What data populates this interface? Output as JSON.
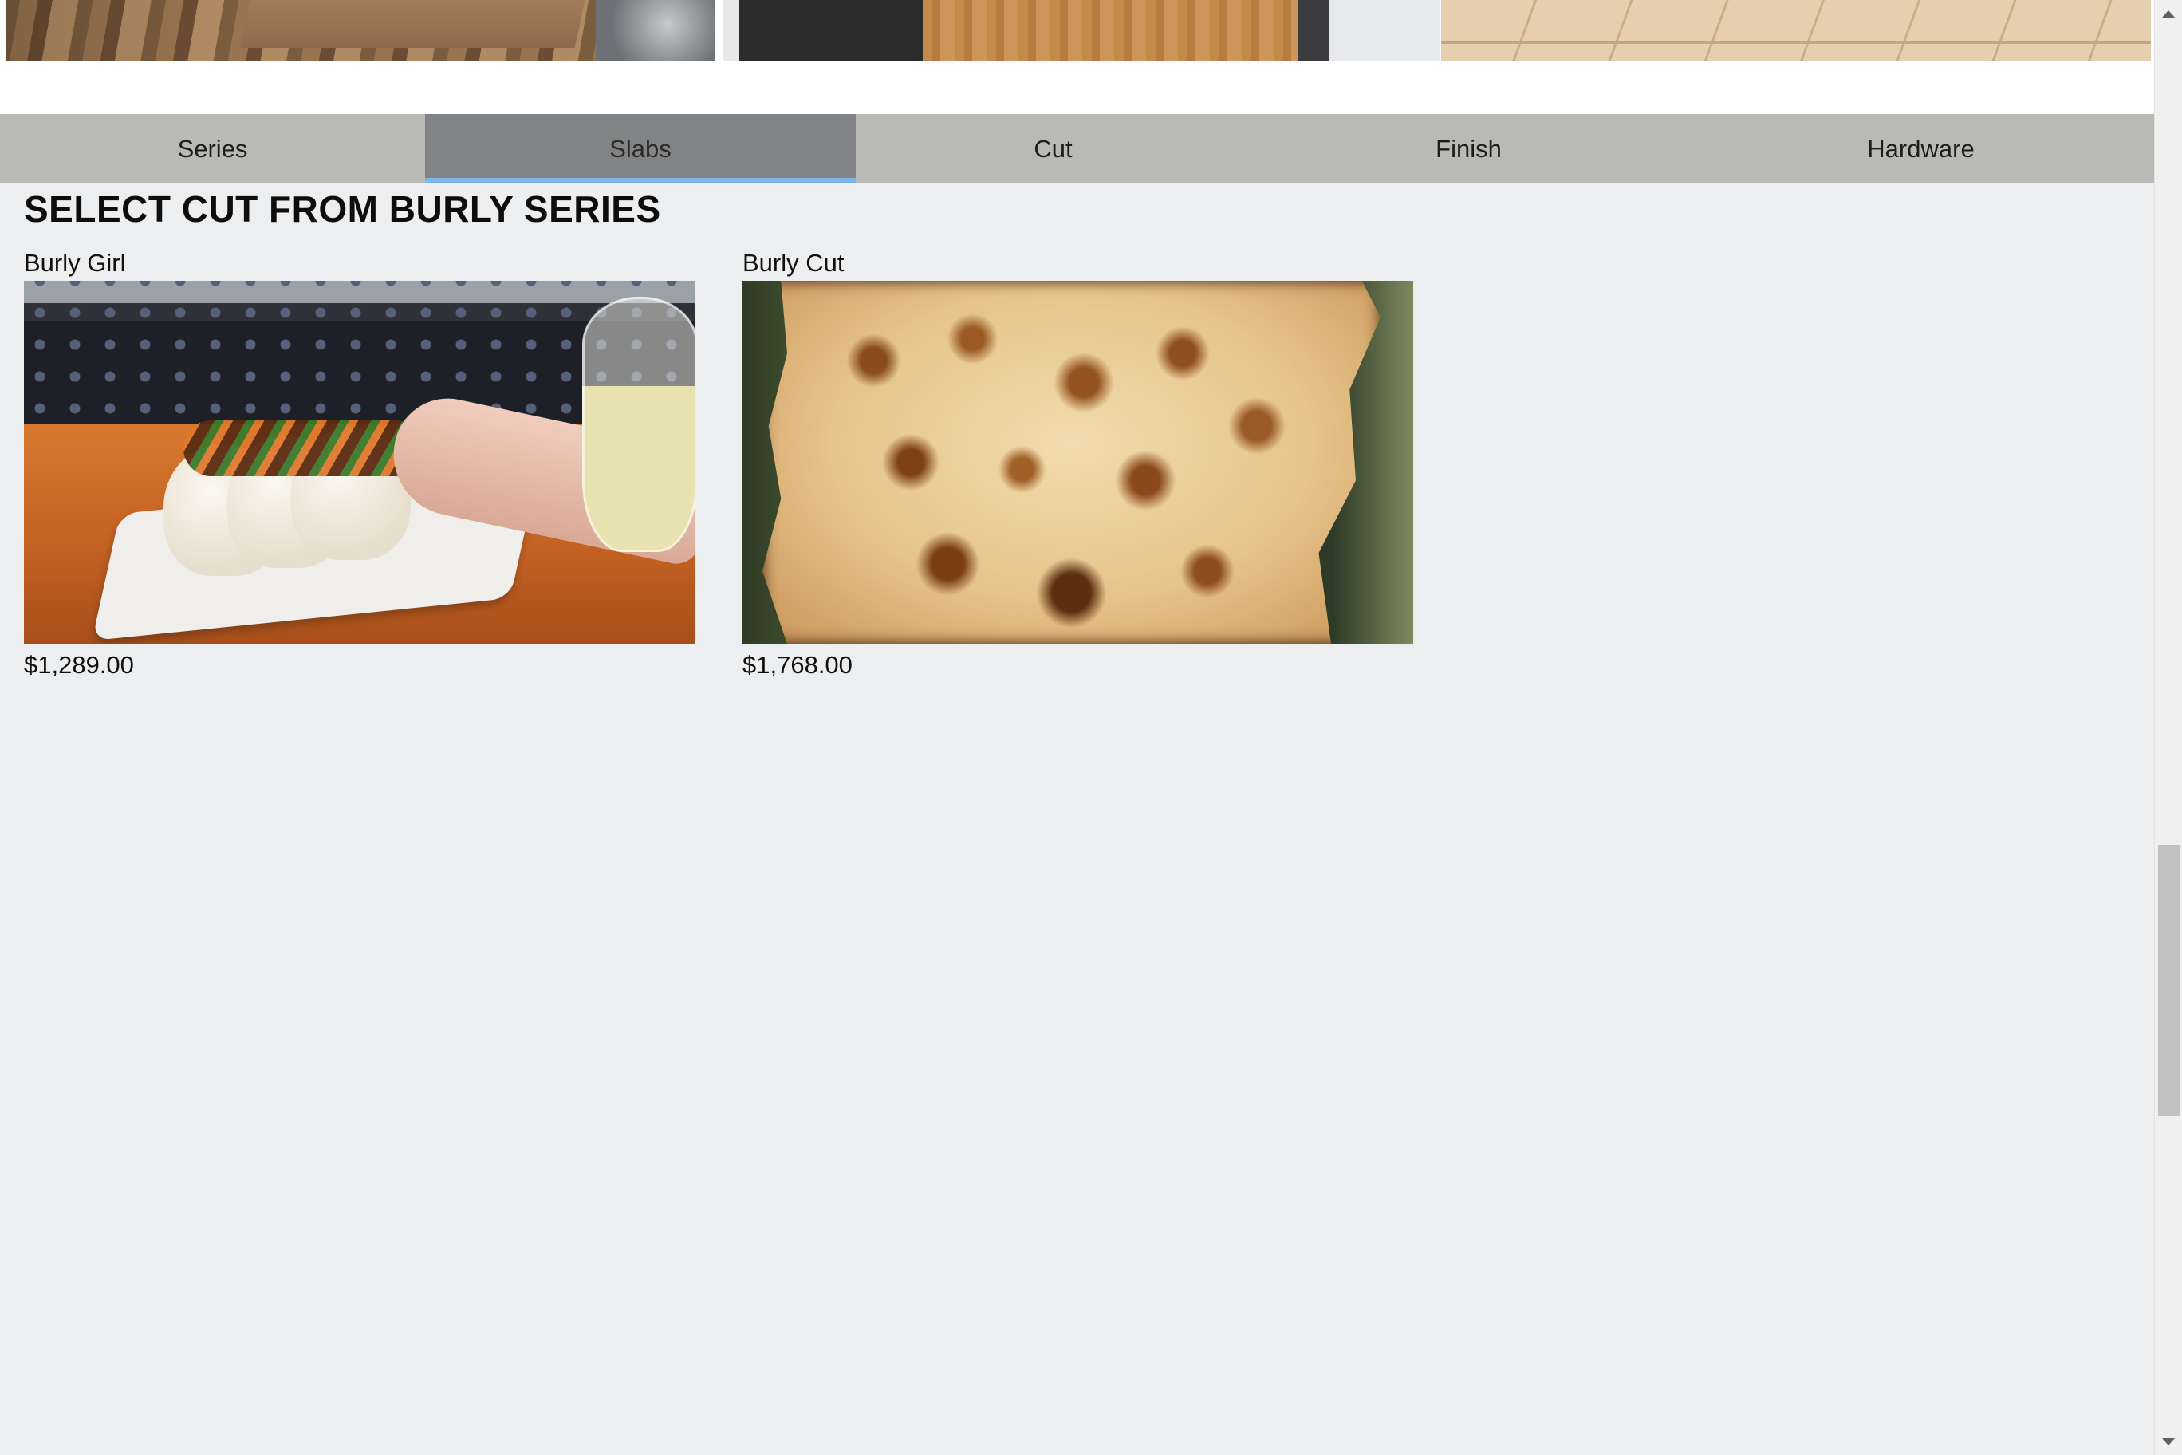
{
  "tabs": [
    {
      "label": "Series",
      "active": false
    },
    {
      "label": "Slabs",
      "active": true
    },
    {
      "label": "Cut",
      "active": false
    },
    {
      "label": "Finish",
      "active": false
    },
    {
      "label": "Hardware",
      "active": false
    }
  ],
  "section": {
    "title": "SELECT CUT FROM BURLY SERIES"
  },
  "products": [
    {
      "name": "Burly Girl",
      "price": "$1,289.00"
    },
    {
      "name": "Burly Cut",
      "price": "$1,768.00"
    }
  ],
  "colors": {
    "tab_bar": "#b9bab6",
    "tab_active": "#828384",
    "tab_active_indicator": "#7fb5e6",
    "page_background": "#edeef0"
  },
  "icons": {
    "scroll_up": "triangle-up-icon",
    "scroll_down": "triangle-down-icon"
  }
}
